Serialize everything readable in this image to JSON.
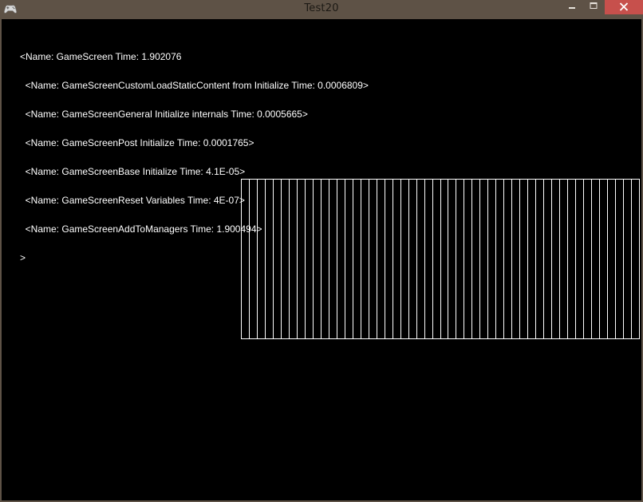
{
  "window": {
    "title": "Test20",
    "icon": "gamepad-icon",
    "controls": [
      "minimize-icon",
      "maximize-icon",
      "close-icon"
    ],
    "close_color": "#c7504c",
    "frame_color": "#5e5246"
  },
  "log": {
    "lines": [
      "<Name: GameScreen Time: 1.902076",
      "  <Name: GameScreenCustomLoadStaticContent from Initialize Time: 0.0006809>",
      "  <Name: GameScreenGeneral Initialize internals Time: 0.0005665>",
      "  <Name: GameScreenPost Initialize Time: 0.0001765>",
      "  <Name: GameScreenBase Initialize Time: 4.1E-05>",
      "  <Name: GameScreenReset Variables Time: 4E-07>",
      "  <Name: GameScreenAddToManagers Time: 1.900494>",
      ">"
    ]
  },
  "grid": {
    "columns": 50,
    "stroke": "#ffffff"
  }
}
